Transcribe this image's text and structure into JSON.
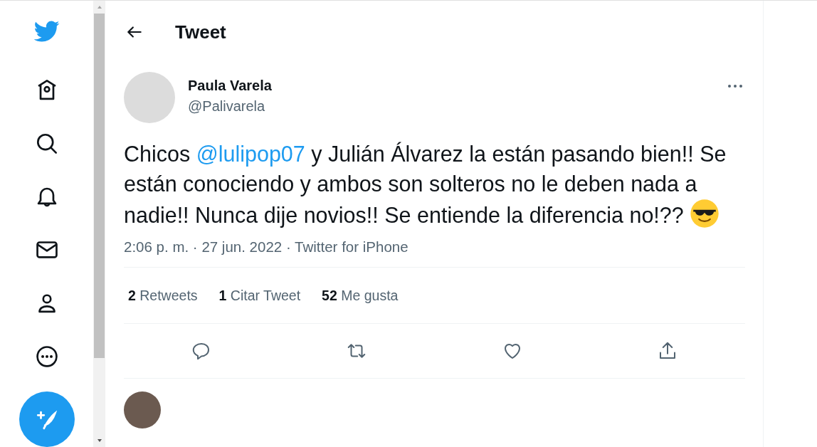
{
  "header": {
    "title": "Tweet"
  },
  "tweet": {
    "author": {
      "name": "Paula Varela",
      "handle": "@Palivarela"
    },
    "text_parts": [
      {
        "kind": "text",
        "text": "Chicos "
      },
      {
        "kind": "mention",
        "text": "@lulipop07"
      },
      {
        "kind": "text",
        "text": " y Julián Álvarez la están pasando bien!! Se están conociendo y ambos son solteros no le deben nada a nadie!! Nunca dije novios!!  Se entiende la diferencia no!?? "
      },
      {
        "kind": "emoji"
      }
    ],
    "meta": "2:06 p. m. · 27 jun. 2022 · Twitter for iPhone",
    "stats": [
      {
        "count": "2",
        "label": "Retweets"
      },
      {
        "count": "1",
        "label": "Citar Tweet"
      },
      {
        "count": "52",
        "label": "Me gusta"
      }
    ],
    "actions": [
      {
        "kind": "reply"
      },
      {
        "kind": "retweet"
      },
      {
        "kind": "like"
      },
      {
        "kind": "share"
      }
    ]
  }
}
